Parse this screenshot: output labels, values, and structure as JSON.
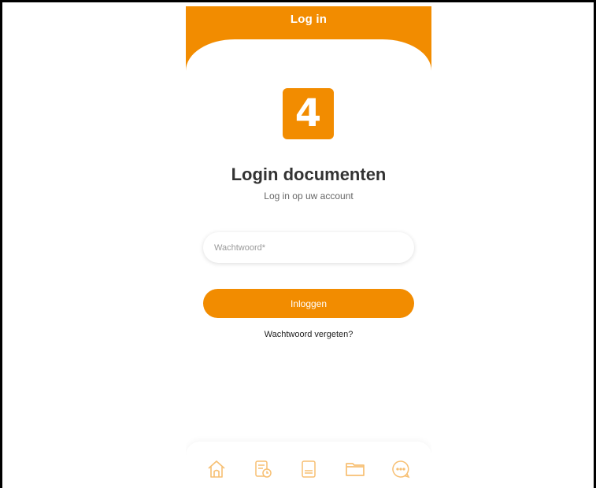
{
  "header": {
    "title": "Log in",
    "color": "#f28c00"
  },
  "logo": {
    "text": "4",
    "color": "#f28c00"
  },
  "page": {
    "title": "Login documenten",
    "subtitle": "Log in op uw account"
  },
  "form": {
    "password_placeholder": "Wachtwoord*",
    "password_value": "",
    "submit_label": "Inloggen",
    "forgot_label": "Wachtwoord vergeten?"
  },
  "bottom_nav": {
    "items": [
      {
        "icon": "home-icon"
      },
      {
        "icon": "document-clock-icon"
      },
      {
        "icon": "document-icon"
      },
      {
        "icon": "folder-icon"
      },
      {
        "icon": "chat-icon"
      }
    ],
    "active_color": "#f28c00"
  }
}
